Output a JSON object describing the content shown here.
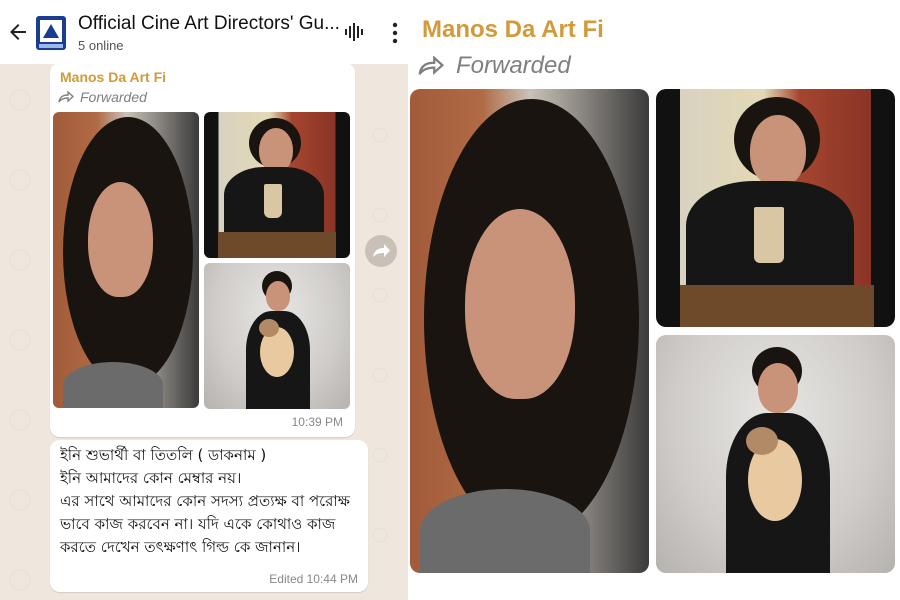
{
  "header": {
    "back_icon": "arrow-left-icon",
    "group_name": "Official Cine Art Directors' Gu...",
    "status": "5 online",
    "voice_icon": "voice-chat-icon",
    "menu_icon": "more-vertical-icon"
  },
  "messages": [
    {
      "type": "album",
      "sender": "Manos Da Art Fi",
      "forwarded_label": "Forwarded",
      "time": "10:39 PM",
      "photo_count": 3
    },
    {
      "type": "text",
      "text": "ইনি শুভার্থী বা তিতলি ( ডাকনাম )\n ইনি আমাদের কোন মেম্বার নয়।\n এর সাথে আমাদের কোন সদস্য প্রত্যক্ষ বা পরোক্ষ ভাবে কাজ করবেন না। যদি একে কোথাও কাজ করতে দেখেন তৎক্ষণাৎ গিল্ড কে জানান।",
      "time": "Edited 10:44 PM"
    }
  ],
  "share_icon": "forward-share-icon",
  "zoomed": {
    "sender": "Manos Da Art Fi",
    "forwarded_label": "Forwarded"
  },
  "colors": {
    "sender": "#d29a3a",
    "header_bg": "#ffffff",
    "chat_bg": "#efe7de",
    "bubble_bg": "#ffffff"
  }
}
